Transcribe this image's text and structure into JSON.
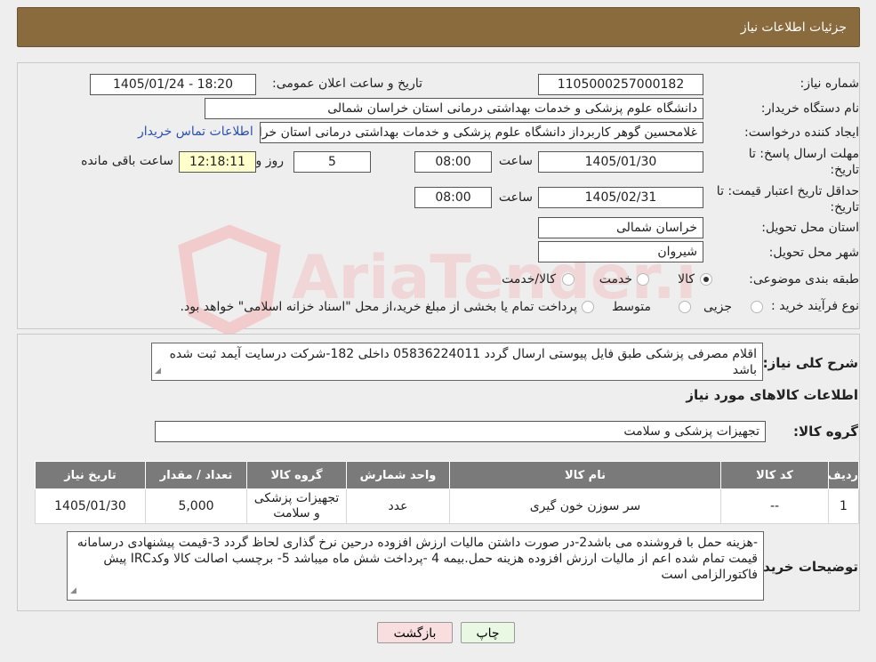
{
  "header": {
    "title": "جزئیات اطلاعات نیاز"
  },
  "need_number": {
    "label": "شماره نیاز:",
    "value": "1105000257000182"
  },
  "announce": {
    "label": "تاریخ و ساعت اعلان عمومی:",
    "value": "1405/01/24 - 18:20"
  },
  "buyer": {
    "label": "نام دستگاه خریدار:",
    "value": "دانشگاه علوم پزشکی و خدمات بهداشتی درمانی استان خراسان شمالی"
  },
  "requester": {
    "label": "ایجاد کننده درخواست:",
    "value": "غلامحسین گوهر کاربرداز  دانشگاه علوم پزشکی و خدمات بهداشتی درمانی استان خراسان شمالی",
    "contact_link": "اطلاعات تماس خریدار"
  },
  "deadline": {
    "label_line1": "مهلت ارسال پاسخ: تا",
    "label_line2": "تاریخ:",
    "date": "1405/01/30",
    "time_label": "ساعت",
    "time": "08:00",
    "days": "5",
    "days_label": "روز و",
    "remaining": "12:18:11",
    "remaining_label": "ساعت باقی مانده"
  },
  "validity": {
    "label_line1": "حداقل تاریخ اعتبار قیمت: تا",
    "label_line2": "تاریخ:",
    "date": "1405/02/31",
    "time_label": "ساعت",
    "time": "08:00"
  },
  "province": {
    "label": "استان محل تحویل:",
    "value": "خراسان شمالی"
  },
  "city": {
    "label": "شهر محل تحویل:",
    "value": "شیروان"
  },
  "category": {
    "label": "طبقه بندی موضوعی:",
    "options": [
      "کالا",
      "خدمت",
      "کالا/خدمت"
    ],
    "selected": 0
  },
  "purchase_type": {
    "label": "نوع فرآیند خرید :",
    "options": [
      "جزیی",
      "متوسط"
    ],
    "selected": -1,
    "note": "پرداخت تمام یا بخشی از مبلغ خرید،از محل \"اسناد خزانه اسلامی\" خواهد بود."
  },
  "summary": {
    "label": "شرح کلی نیاز:",
    "text": "اقلام مصرفی پزشکی طبق فایل پیوستی ارسال گردد 05836224011 داخلی 182-شرکت درسایت آیمد ثبت شده باشد"
  },
  "goods_info": {
    "title": "اطلاعات کالاهای مورد نیاز"
  },
  "goods_group": {
    "label": "گروه کالا:",
    "value": "تجهیزات پزشکی و سلامت"
  },
  "table": {
    "headers": [
      "ردیف",
      "کد کالا",
      "نام کالا",
      "واحد شمارش",
      "گروه کالا",
      "تعداد / مقدار",
      "تاریخ نیاز"
    ],
    "rows": [
      [
        "1",
        "--",
        "سر سوزن خون گیری",
        "عدد",
        "تجهیزات پزشکی و سلامت",
        "5,000",
        "1405/01/30"
      ]
    ]
  },
  "buyer_notes": {
    "label": "توضیحات خریدار:",
    "text": "-هزینه حمل با فروشنده می باشد2-در صورت داشتن مالیات ارزش افزوده درحین نرخ گذاری لحاظ گردد 3-قیمت پیشنهادی درسامانه  قیمت تمام شده اعم از مالیات ارزش افزوده هزینه حمل.بیمه  4 -پرداخت شش ماه میباشد 5- برچسب اصالت کالا وکدIRC پیش فاکتورالزامی است"
  },
  "buttons": {
    "print": "چاپ",
    "back": "بازگشت"
  },
  "watermark": {
    "text": "AriaTender.neT"
  }
}
